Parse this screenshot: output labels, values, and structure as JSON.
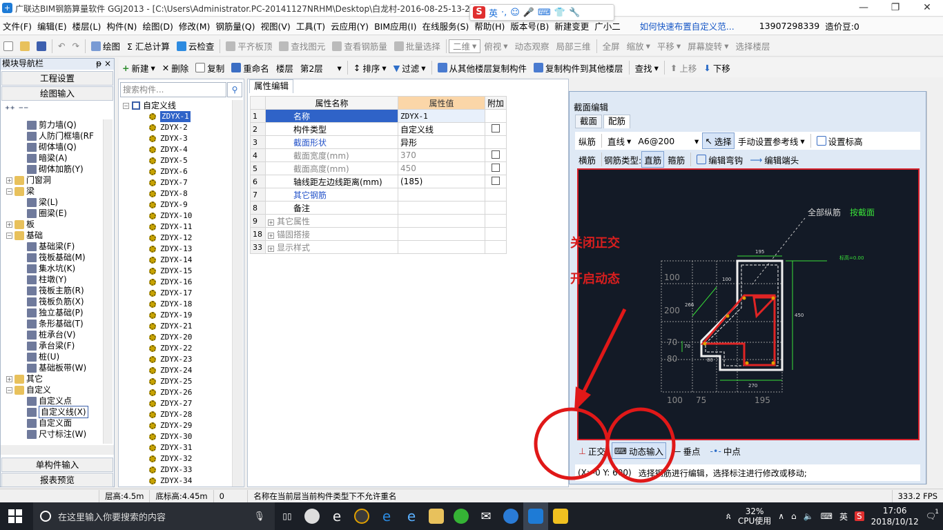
{
  "window": {
    "title": "广联达BIM钢筋算量软件 GGJ2013 - [C:\\Users\\Administrator.PC-20141127NRHM\\Desktop\\白龙村-2016-08-25-13-27",
    "minimize": "—",
    "restore": "❐",
    "close": "✕"
  },
  "ime": {
    "logo": "S",
    "lang": "英",
    "items": [
      "·,",
      "☺",
      "🎤",
      "⌨",
      "👕",
      "🔧"
    ]
  },
  "menubar": {
    "items": [
      "文件(F)",
      "编辑(E)",
      "楼层(L)",
      "构件(N)",
      "绘图(D)",
      "修改(M)",
      "钢筋量(Q)",
      "视图(V)",
      "工具(T)",
      "云应用(Y)",
      "BIM应用(I)",
      "在线服务(S)",
      "帮助(H)",
      "版本号(B)",
      "新建变更",
      "广小二"
    ],
    "help_link": "如何快速布置自定义范...",
    "phone": "13907298339",
    "price": "造价豆:0"
  },
  "toolbar1": {
    "items": [
      "绘图",
      "Σ 汇总计算",
      "云检查",
      "平齐板顶",
      "查找图元",
      "查看钢筋量",
      "批量选择",
      "二维",
      "俯视",
      "动态观察",
      "局部三维",
      "全屏",
      "缩放",
      "平移",
      "屏幕旋转",
      "选择楼层"
    ]
  },
  "toolbar2": {
    "new": "新建",
    "delete": "删除",
    "copy": "复制",
    "rename": "重命名",
    "floor_label": "楼层",
    "floor_value": "第2层",
    "sort": "排序",
    "filter": "过滤",
    "copy_from": "从其他楼层复制构件",
    "copy_to": "复制构件到其他楼层",
    "find": "查找",
    "up": "上移",
    "down": "下移"
  },
  "nav": {
    "header": "模块导航栏",
    "pin": "ᵽ ×",
    "btn_project": "工程设置",
    "btn_draw": "绘图输入",
    "btn_single": "单构件输入",
    "btn_report": "报表预览",
    "tree": [
      {
        "label": "剪力墙(Q)",
        "level": 2
      },
      {
        "label": "人防门框墙(RF",
        "level": 2
      },
      {
        "label": "砌体墙(Q)",
        "level": 2
      },
      {
        "label": "暗梁(A)",
        "level": 2
      },
      {
        "label": "砌体加筋(Y)",
        "level": 2
      },
      {
        "label": "门窗洞",
        "level": 1,
        "folder": true,
        "exp": "+"
      },
      {
        "label": "梁",
        "level": 1,
        "folder": true,
        "exp": "−"
      },
      {
        "label": "梁(L)",
        "level": 2
      },
      {
        "label": "圈梁(E)",
        "level": 2
      },
      {
        "label": "板",
        "level": 1,
        "folder": true,
        "exp": "+"
      },
      {
        "label": "基础",
        "level": 1,
        "folder": true,
        "exp": "−"
      },
      {
        "label": "基础梁(F)",
        "level": 2
      },
      {
        "label": "筏板基础(M)",
        "level": 2
      },
      {
        "label": "集水坑(K)",
        "level": 2
      },
      {
        "label": "柱墩(Y)",
        "level": 2
      },
      {
        "label": "筏板主筋(R)",
        "level": 2
      },
      {
        "label": "筏板负筋(X)",
        "level": 2
      },
      {
        "label": "独立基础(P)",
        "level": 2
      },
      {
        "label": "条形基础(T)",
        "level": 2
      },
      {
        "label": "桩承台(V)",
        "level": 2
      },
      {
        "label": "承台梁(F)",
        "level": 2
      },
      {
        "label": "桩(U)",
        "level": 2
      },
      {
        "label": "基础板带(W)",
        "level": 2
      },
      {
        "label": "其它",
        "level": 1,
        "folder": true,
        "exp": "+"
      },
      {
        "label": "自定义",
        "level": 1,
        "folder": true,
        "exp": "−"
      },
      {
        "label": "自定义点",
        "level": 2
      },
      {
        "label": "自定义线(X)",
        "level": 2,
        "selected": true
      },
      {
        "label": "自定义面",
        "level": 2
      },
      {
        "label": "尺寸标注(W)",
        "level": 2
      }
    ]
  },
  "components": {
    "search_placeholder": "搜索构件...",
    "root": "自定义线",
    "items": [
      "ZDYX-1",
      "ZDYX-2",
      "ZDYX-3",
      "ZDYX-4",
      "ZDYX-5",
      "ZDYX-6",
      "ZDYX-7",
      "ZDYX-8",
      "ZDYX-9",
      "ZDYX-10",
      "ZDYX-11",
      "ZDYX-12",
      "ZDYX-13",
      "ZDYX-14",
      "ZDYX-15",
      "ZDYX-16",
      "ZDYX-17",
      "ZDYX-18",
      "ZDYX-19",
      "ZDYX-21",
      "ZDYX-20",
      "ZDYX-22",
      "ZDYX-23",
      "ZDYX-24",
      "ZDYX-25",
      "ZDYX-26",
      "ZDYX-27",
      "ZDYX-28",
      "ZDYX-29",
      "ZDYX-30",
      "ZDYX-31",
      "ZDYX-32",
      "ZDYX-33",
      "ZDYX-34"
    ]
  },
  "props": {
    "tab": "属性编辑",
    "col_name": "属性名称",
    "col_value": "属性值",
    "col_extra": "附加",
    "rows": [
      {
        "n": "1",
        "name": "名称",
        "value": "ZDYX-1",
        "style": "blue",
        "check": false,
        "exp": ""
      },
      {
        "n": "2",
        "name": "构件类型",
        "value": "自定义线",
        "style": "",
        "check": true,
        "exp": ""
      },
      {
        "n": "3",
        "name": "截面形状",
        "value": "异形",
        "style": "blue",
        "check": false,
        "exp": ""
      },
      {
        "n": "4",
        "name": "截面宽度(mm)",
        "value": "370",
        "style": "grey",
        "check": true,
        "exp": ""
      },
      {
        "n": "5",
        "name": "截面高度(mm)",
        "value": "450",
        "style": "grey",
        "check": true,
        "exp": ""
      },
      {
        "n": "6",
        "name": "轴线距左边线距离(mm)",
        "value": "(185)",
        "style": "",
        "check": true,
        "exp": ""
      },
      {
        "n": "7",
        "name": "其它钢筋",
        "value": "",
        "style": "blue",
        "check": false,
        "exp": ""
      },
      {
        "n": "8",
        "name": "备注",
        "value": "",
        "style": "",
        "check": false,
        "exp": ""
      },
      {
        "n": "9",
        "name": "其它属性",
        "value": "",
        "style": "grey",
        "check": false,
        "exp": "+"
      },
      {
        "n": "18",
        "name": "锚固搭接",
        "value": "",
        "style": "grey",
        "check": false,
        "exp": "+"
      },
      {
        "n": "33",
        "name": "显示样式",
        "value": "",
        "style": "grey",
        "check": false,
        "exp": "+"
      }
    ]
  },
  "section_editor": {
    "title": "截面编辑",
    "tab_section": "截面",
    "tab_rebar": "配筋",
    "t1": [
      "纵筋",
      "直线",
      "A6@200",
      "选择",
      "手动设置参考线",
      "设置标高"
    ],
    "t2": [
      "横筋",
      "钢筋类型:",
      "直筋",
      "箍筋",
      "编辑弯钩",
      "编辑端头"
    ],
    "canvas_label_all": "全部纵筋",
    "canvas_label_section": "按截面",
    "dims": {
      "top": "195",
      "right": "450",
      "bottom": "270",
      "d100": "100",
      "d266": "266",
      "d70": "70",
      "d80": "80",
      "elev": "标高=0.00"
    },
    "left_dims": [
      "100",
      "200",
      "70",
      "80"
    ],
    "bottom_dims": [
      "100",
      "75",
      "195"
    ],
    "bottom_tools": [
      "正交",
      "动态输入",
      "垂点",
      "中点"
    ],
    "status_coord": "(X: -0 Y: 600)",
    "status_msg": "选择钢筋进行编辑，选择标注进行修改或移动;"
  },
  "annotations": {
    "close_ortho": "关闭正交",
    "open_dynamic": "开启动态"
  },
  "statusbar": {
    "floor_height": "层高:4.5m",
    "bottom_elev": "底标高:4.45m",
    "zero": "0",
    "message": "名称在当前层当前构件类型下不允许重名",
    "fps": "333.2 FPS"
  },
  "taskbar": {
    "search": "在这里输入你要搜索的内容",
    "cpu_pct": "32%",
    "cpu_label": "CPU使用",
    "lang": "英",
    "time": "17:06",
    "date": "2018/10/12",
    "notif": "1"
  },
  "colors": {
    "accent": "#2f63c8",
    "annotation": "#d81e1e",
    "canvas_bg": "#131a26"
  }
}
